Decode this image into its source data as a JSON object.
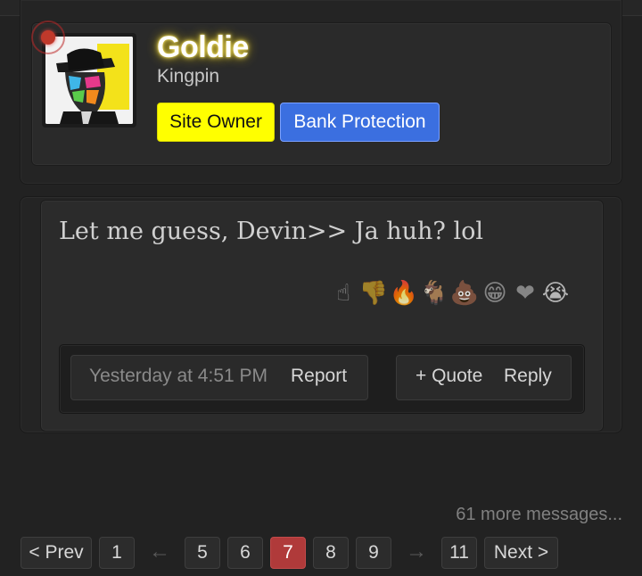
{
  "user": {
    "name": "Goldie",
    "title": "Kingpin",
    "badges": [
      "Site Owner",
      "Bank Protection"
    ]
  },
  "post": {
    "message": "Let me guess, Devin>> Ja huh? lol",
    "reactions": [
      {
        "icon": "raised-finger-icon",
        "glyph": "☝"
      },
      {
        "icon": "thumbs-down-icon",
        "glyph": "👎"
      },
      {
        "icon": "fire-icon",
        "glyph": "🔥"
      },
      {
        "icon": "goat-icon",
        "glyph": "🐐"
      },
      {
        "icon": "poop-icon",
        "glyph": "💩"
      },
      {
        "icon": "grin-icon",
        "glyph": "😁"
      },
      {
        "icon": "heart-icon",
        "glyph": "❤"
      },
      {
        "icon": "crying-face-icon",
        "glyph": "😭"
      }
    ],
    "timestamp": "Yesterday at 4:51 PM",
    "report_label": "Report",
    "quote_label": "+ Quote",
    "reply_label": "Reply"
  },
  "more_messages": "61 more messages...",
  "pagination": {
    "prev": "< Prev",
    "next": "Next >",
    "pages": [
      "1",
      "5",
      "6",
      "7",
      "8",
      "9",
      "11"
    ],
    "current": "7",
    "back_arrow": "←",
    "forward_arrow": "→"
  },
  "colors": {
    "owner_badge": "#ffff00",
    "bank_badge": "#3b6fe0",
    "current_page": "#b03a3a",
    "background": "#222222"
  }
}
